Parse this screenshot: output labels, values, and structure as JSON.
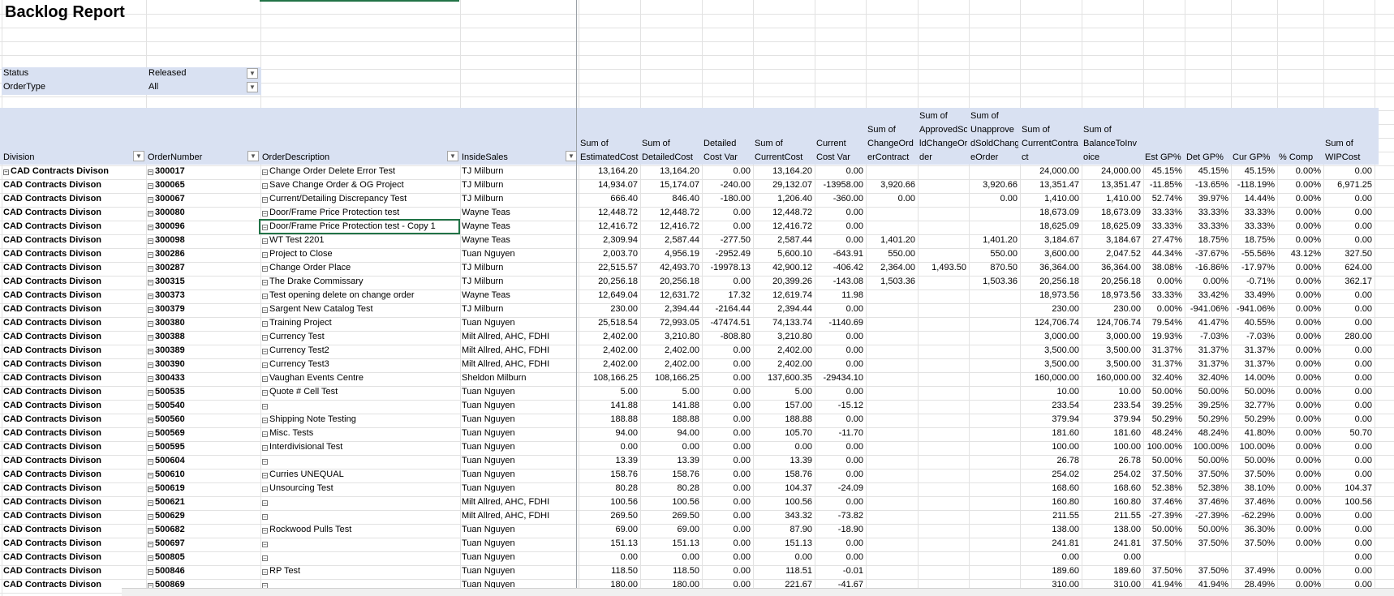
{
  "report": {
    "title": "Backlog Report"
  },
  "filters": [
    {
      "label": "Status",
      "value": "Released",
      "filtered": true
    },
    {
      "label": "OrderType",
      "value": "All",
      "filtered": false
    }
  ],
  "columns": [
    {
      "key": "division",
      "label": "Division",
      "width": 178,
      "align": "left",
      "dropdown": true
    },
    {
      "key": "order",
      "label": "OrderNumber",
      "width": 141,
      "align": "left",
      "dropdown": true
    },
    {
      "key": "desc",
      "label": "OrderDescription",
      "width": 246,
      "align": "left",
      "dropdown": true
    },
    {
      "key": "sales",
      "label": "InsideSales",
      "width": 146,
      "align": "left",
      "dropdown": true
    },
    {
      "key": "est",
      "label": "Sum of\nEstimatedCost",
      "width": 76,
      "align": "right"
    },
    {
      "key": "det",
      "label": "Sum of\nDetailedCost",
      "width": 76,
      "align": "right"
    },
    {
      "key": "detvar",
      "label": "Detailed\nCost Var",
      "width": 63,
      "align": "right"
    },
    {
      "key": "cur",
      "label": "Sum of\nCurrentCost",
      "width": 76,
      "align": "right"
    },
    {
      "key": "curvar",
      "label": "Current\nCost Var",
      "width": 63,
      "align": "right"
    },
    {
      "key": "chg",
      "label": "Sum of\nChangeOrd\nerContract",
      "width": 64,
      "align": "right"
    },
    {
      "key": "appr",
      "label": "Sum of\nApprovedSo\nldChangeOr\nder",
      "width": 63,
      "align": "right"
    },
    {
      "key": "unappr",
      "label": "Sum of\nUnapprove\ndSoldChang\neOrder",
      "width": 63,
      "align": "right"
    },
    {
      "key": "contract",
      "label": "Sum of\nCurrentContra\nct",
      "width": 76,
      "align": "right"
    },
    {
      "key": "bal",
      "label": "Sum of\nBalanceToInv\noice",
      "width": 76,
      "align": "right"
    },
    {
      "key": "estgp",
      "label": "Est GP%",
      "width": 51,
      "align": "right"
    },
    {
      "key": "detgp",
      "label": "Det GP%",
      "width": 57,
      "align": "right"
    },
    {
      "key": "curgp",
      "label": "Cur GP%",
      "width": 57,
      "align": "right"
    },
    {
      "key": "comp",
      "label": "% Comp",
      "width": 57,
      "align": "right"
    },
    {
      "key": "wip",
      "label": "Sum of\nWIPCost",
      "width": 63,
      "align": "right"
    }
  ],
  "rows": [
    [
      "CAD Contracts Divison",
      "300017",
      "Change Order Delete Error Test",
      "TJ Milburn",
      "13,164.20",
      "13,164.20",
      "0.00",
      "13,164.20",
      "0.00",
      "",
      "",
      "",
      "24,000.00",
      "24,000.00",
      "45.15%",
      "45.15%",
      "45.15%",
      "0.00%",
      "0.00"
    ],
    [
      "CAD Contracts Divison",
      "300065",
      "Save Change Order & OG Project",
      "TJ Milburn",
      "14,934.07",
      "15,174.07",
      "-240.00",
      "29,132.07",
      "-13958.00",
      "3,920.66",
      "",
      "3,920.66",
      "13,351.47",
      "13,351.47",
      "-11.85%",
      "-13.65%",
      "-118.19%",
      "0.00%",
      "6,971.25"
    ],
    [
      "CAD Contracts Divison",
      "300067",
      "Current/Detailing Discrepancy Test",
      "TJ Milburn",
      "666.40",
      "846.40",
      "-180.00",
      "1,206.40",
      "-360.00",
      "0.00",
      "",
      "0.00",
      "1,410.00",
      "1,410.00",
      "52.74%",
      "39.97%",
      "14.44%",
      "0.00%",
      "0.00"
    ],
    [
      "CAD Contracts Divison",
      "300080",
      "Door/Frame Price Protection test",
      "Wayne Teas",
      "12,448.72",
      "12,448.72",
      "0.00",
      "12,448.72",
      "0.00",
      "",
      "",
      "",
      "18,673.09",
      "18,673.09",
      "33.33%",
      "33.33%",
      "33.33%",
      "0.00%",
      "0.00"
    ],
    [
      "CAD Contracts Divison",
      "300096",
      "Door/Frame Price Protection test - Copy 1",
      "Wayne Teas",
      "12,416.72",
      "12,416.72",
      "0.00",
      "12,416.72",
      "0.00",
      "",
      "",
      "",
      "18,625.09",
      "18,625.09",
      "33.33%",
      "33.33%",
      "33.33%",
      "0.00%",
      "0.00"
    ],
    [
      "CAD Contracts Divison",
      "300098",
      "WT  Test 2201",
      "Wayne Teas",
      "2,309.94",
      "2,587.44",
      "-277.50",
      "2,587.44",
      "0.00",
      "1,401.20",
      "",
      "1,401.20",
      "3,184.67",
      "3,184.67",
      "27.47%",
      "18.75%",
      "18.75%",
      "0.00%",
      "0.00"
    ],
    [
      "CAD Contracts Divison",
      "300286",
      "Project to Close",
      "Tuan Nguyen",
      "2,003.70",
      "4,956.19",
      "-2952.49",
      "5,600.10",
      "-643.91",
      "550.00",
      "",
      "550.00",
      "3,600.00",
      "2,047.52",
      "44.34%",
      "-37.67%",
      "-55.56%",
      "43.12%",
      "327.50"
    ],
    [
      "CAD Contracts Divison",
      "300287",
      "Change Order Place",
      "TJ Milburn",
      "22,515.57",
      "42,493.70",
      "-19978.13",
      "42,900.12",
      "-406.42",
      "2,364.00",
      "1,493.50",
      "870.50",
      "36,364.00",
      "36,364.00",
      "38.08%",
      "-16.86%",
      "-17.97%",
      "0.00%",
      "624.00"
    ],
    [
      "CAD Contracts Divison",
      "300315",
      "The Drake Commissary",
      "TJ Milburn",
      "20,256.18",
      "20,256.18",
      "0.00",
      "20,399.26",
      "-143.08",
      "1,503.36",
      "",
      "1,503.36",
      "20,256.18",
      "20,256.18",
      "0.00%",
      "0.00%",
      "-0.71%",
      "0.00%",
      "362.17"
    ],
    [
      "CAD Contracts Divison",
      "300373",
      "Test opening delete on change order",
      "Wayne Teas",
      "12,649.04",
      "12,631.72",
      "17.32",
      "12,619.74",
      "11.98",
      "",
      "",
      "",
      "18,973.56",
      "18,973.56",
      "33.33%",
      "33.42%",
      "33.49%",
      "0.00%",
      "0.00"
    ],
    [
      "CAD Contracts Divison",
      "300379",
      "Sargent New Catalog Test",
      "TJ Milburn",
      "230.00",
      "2,394.44",
      "-2164.44",
      "2,394.44",
      "0.00",
      "",
      "",
      "",
      "230.00",
      "230.00",
      "0.00%",
      "-941.06%",
      "-941.06%",
      "0.00%",
      "0.00"
    ],
    [
      "CAD Contracts Divison",
      "300380",
      "Training Project",
      "Tuan Nguyen",
      "25,518.54",
      "72,993.05",
      "-47474.51",
      "74,133.74",
      "-1140.69",
      "",
      "",
      "",
      "124,706.74",
      "124,706.74",
      "79.54%",
      "41.47%",
      "40.55%",
      "0.00%",
      "0.00"
    ],
    [
      "CAD Contracts Divison",
      "300388",
      "Currency Test",
      "Milt Allred, AHC, FDHI",
      "2,402.00",
      "3,210.80",
      "-808.80",
      "3,210.80",
      "0.00",
      "",
      "",
      "",
      "3,000.00",
      "3,000.00",
      "19.93%",
      "-7.03%",
      "-7.03%",
      "0.00%",
      "280.00"
    ],
    [
      "CAD Contracts Divison",
      "300389",
      "Currency Test2",
      "Milt Allred, AHC, FDHI",
      "2,402.00",
      "2,402.00",
      "0.00",
      "2,402.00",
      "0.00",
      "",
      "",
      "",
      "3,500.00",
      "3,500.00",
      "31.37%",
      "31.37%",
      "31.37%",
      "0.00%",
      "0.00"
    ],
    [
      "CAD Contracts Divison",
      "300390",
      "Currency Test3",
      "Milt Allred, AHC, FDHI",
      "2,402.00",
      "2,402.00",
      "0.00",
      "2,402.00",
      "0.00",
      "",
      "",
      "",
      "3,500.00",
      "3,500.00",
      "31.37%",
      "31.37%",
      "31.37%",
      "0.00%",
      "0.00"
    ],
    [
      "CAD Contracts Divison",
      "300433",
      "Vaughan Events Centre",
      "Sheldon Milburn",
      "108,166.25",
      "108,166.25",
      "0.00",
      "137,600.35",
      "-29434.10",
      "",
      "",
      "",
      "160,000.00",
      "160,000.00",
      "32.40%",
      "32.40%",
      "14.00%",
      "0.00%",
      "0.00"
    ],
    [
      "CAD Contracts Divison",
      "500535",
      "Quote # Cell Test",
      "Tuan Nguyen",
      "5.00",
      "5.00",
      "0.00",
      "5.00",
      "0.00",
      "",
      "",
      "",
      "10.00",
      "10.00",
      "50.00%",
      "50.00%",
      "50.00%",
      "0.00%",
      "0.00"
    ],
    [
      "CAD Contracts Divison",
      "500540",
      "",
      "Tuan Nguyen",
      "141.88",
      "141.88",
      "0.00",
      "157.00",
      "-15.12",
      "",
      "",
      "",
      "233.54",
      "233.54",
      "39.25%",
      "39.25%",
      "32.77%",
      "0.00%",
      "0.00"
    ],
    [
      "CAD Contracts Divison",
      "500560",
      "Shipping Note Testing",
      "Tuan Nguyen",
      "188.88",
      "188.88",
      "0.00",
      "188.88",
      "0.00",
      "",
      "",
      "",
      "379.94",
      "379.94",
      "50.29%",
      "50.29%",
      "50.29%",
      "0.00%",
      "0.00"
    ],
    [
      "CAD Contracts Divison",
      "500569",
      "Misc. Tests",
      "Tuan Nguyen",
      "94.00",
      "94.00",
      "0.00",
      "105.70",
      "-11.70",
      "",
      "",
      "",
      "181.60",
      "181.60",
      "48.24%",
      "48.24%",
      "41.80%",
      "0.00%",
      "50.70"
    ],
    [
      "CAD Contracts Divison",
      "500595",
      "Interdivisional Test",
      "Tuan Nguyen",
      "0.00",
      "0.00",
      "0.00",
      "0.00",
      "0.00",
      "",
      "",
      "",
      "100.00",
      "100.00",
      "100.00%",
      "100.00%",
      "100.00%",
      "0.00%",
      "0.00"
    ],
    [
      "CAD Contracts Divison",
      "500604",
      "",
      "Tuan Nguyen",
      "13.39",
      "13.39",
      "0.00",
      "13.39",
      "0.00",
      "",
      "",
      "",
      "26.78",
      "26.78",
      "50.00%",
      "50.00%",
      "50.00%",
      "0.00%",
      "0.00"
    ],
    [
      "CAD Contracts Divison",
      "500610",
      "Curries UNEQUAL",
      "Tuan Nguyen",
      "158.76",
      "158.76",
      "0.00",
      "158.76",
      "0.00",
      "",
      "",
      "",
      "254.02",
      "254.02",
      "37.50%",
      "37.50%",
      "37.50%",
      "0.00%",
      "0.00"
    ],
    [
      "CAD Contracts Divison",
      "500619",
      "Unsourcing Test",
      "Tuan Nguyen",
      "80.28",
      "80.28",
      "0.00",
      "104.37",
      "-24.09",
      "",
      "",
      "",
      "168.60",
      "168.60",
      "52.38%",
      "52.38%",
      "38.10%",
      "0.00%",
      "104.37"
    ],
    [
      "CAD Contracts Divison",
      "500621",
      "",
      "Milt Allred, AHC, FDHI",
      "100.56",
      "100.56",
      "0.00",
      "100.56",
      "0.00",
      "",
      "",
      "",
      "160.80",
      "160.80",
      "37.46%",
      "37.46%",
      "37.46%",
      "0.00%",
      "100.56"
    ],
    [
      "CAD Contracts Divison",
      "500629",
      "",
      "Milt Allred, AHC, FDHI",
      "269.50",
      "269.50",
      "0.00",
      "343.32",
      "-73.82",
      "",
      "",
      "",
      "211.55",
      "211.55",
      "-27.39%",
      "-27.39%",
      "-62.29%",
      "0.00%",
      "0.00"
    ],
    [
      "CAD Contracts Divison",
      "500682",
      "Rockwood Pulls Test",
      "Tuan Nguyen",
      "69.00",
      "69.00",
      "0.00",
      "87.90",
      "-18.90",
      "",
      "",
      "",
      "138.00",
      "138.00",
      "50.00%",
      "50.00%",
      "36.30%",
      "0.00%",
      "0.00"
    ],
    [
      "CAD Contracts Divison",
      "500697",
      "",
      "Tuan Nguyen",
      "151.13",
      "151.13",
      "0.00",
      "151.13",
      "0.00",
      "",
      "",
      "",
      "241.81",
      "241.81",
      "37.50%",
      "37.50%",
      "37.50%",
      "0.00%",
      "0.00"
    ],
    [
      "CAD Contracts Divison",
      "500805",
      "",
      "Tuan Nguyen",
      "0.00",
      "0.00",
      "0.00",
      "0.00",
      "0.00",
      "",
      "",
      "",
      "0.00",
      "0.00",
      "",
      "",
      "",
      "",
      "0.00"
    ],
    [
      "CAD Contracts Divison",
      "500846",
      "RP Test",
      "Tuan Nguyen",
      "118.50",
      "118.50",
      "0.00",
      "118.51",
      "-0.01",
      "",
      "",
      "",
      "189.60",
      "189.60",
      "37.50%",
      "37.50%",
      "37.49%",
      "0.00%",
      "0.00"
    ],
    [
      "CAD Contracts Divison",
      "500869",
      "",
      "Tuan Nguyen",
      "180.00",
      "180.00",
      "0.00",
      "221.67",
      "-41.67",
      "",
      "",
      "",
      "310.00",
      "310.00",
      "41.94%",
      "41.94%",
      "28.49%",
      "0.00%",
      "0.00"
    ]
  ]
}
